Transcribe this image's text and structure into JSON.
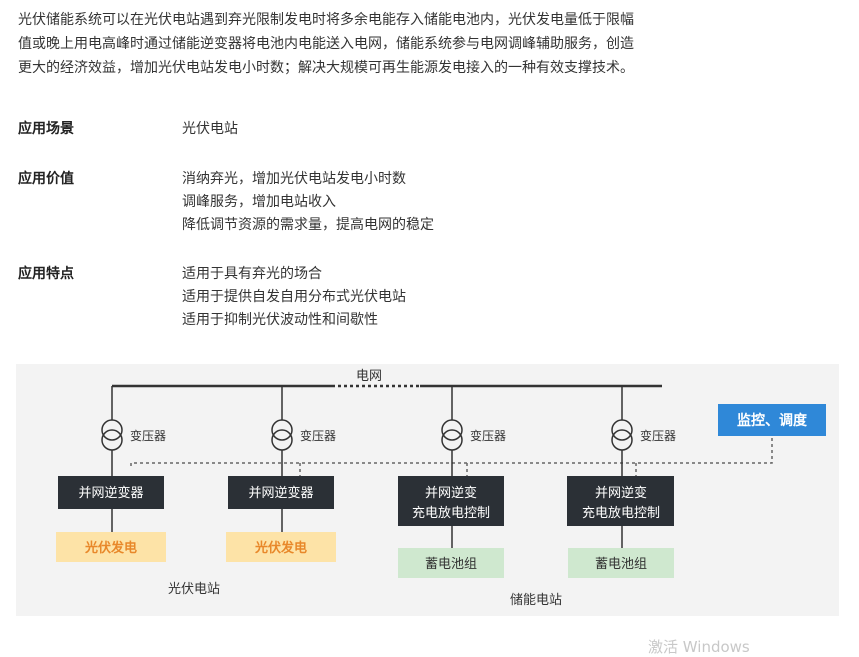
{
  "intro": {
    "lines": [
      "光伏储能系统可以在光伏电站遇到弃光限制发电时将多余电能存入储能电池内，光伏发电量低于限幅",
      "值或晚上用电高峰时通过储能逆变器将电池内电能送入电网，储能系统参与电网调峰辅助服务，创造",
      "更大的经济效益，增加光伏电站发电小时数；解决大规模可再生能源发电接入的一种有效支撑技术。"
    ]
  },
  "sections": [
    {
      "label": "应用场景",
      "values": [
        "光伏电站"
      ]
    },
    {
      "label": "应用价值",
      "values": [
        "消纳弃光，增加光伏电站发电小时数",
        "调峰服务，增加电站收入",
        "降低调节资源的需求量，提高电网的稳定"
      ]
    },
    {
      "label": "应用特点",
      "values": [
        "适用于具有弃光的场合",
        "适用于提供自发自用分布式光伏电站",
        "适用于抑制光伏波动性和间歇性"
      ]
    }
  ],
  "diagram": {
    "grid_label": "电网",
    "monitor_label": "监控、调度",
    "transformer_label": "变压器",
    "inverter_label": "并网逆变器",
    "storage_inverter_lines": [
      "并网逆变",
      "充电放电控制"
    ],
    "pv_label": "光伏发电",
    "battery_label": "蓄电池组",
    "pv_station_label": "光伏电站",
    "storage_station_label": "储能电站",
    "colors": {
      "background": "#f3f3f3",
      "dark_box": "#2b3036",
      "pv_box": "#fde3a7",
      "pv_text": "#e8882a",
      "battery_box": "#cfe8cf",
      "monitor_box": "#2f88d8"
    }
  },
  "watermark": "激活 Windows"
}
